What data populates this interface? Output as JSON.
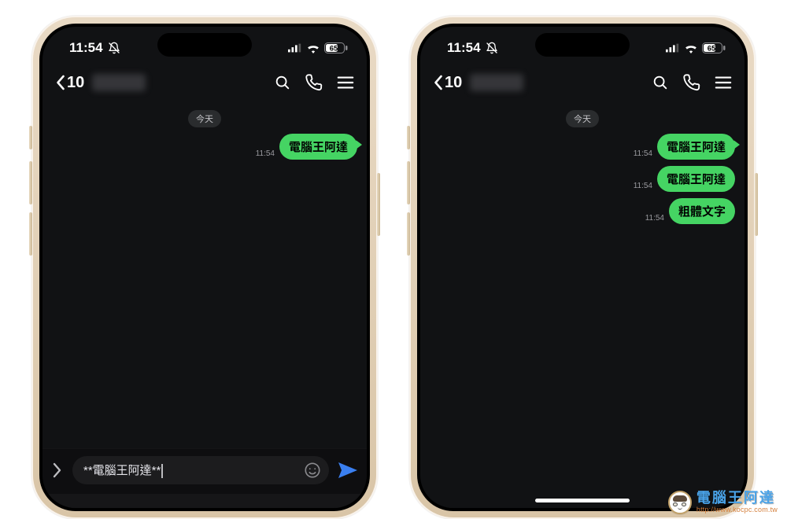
{
  "status": {
    "time": "11:54",
    "mute_icon": "bell-slash-icon",
    "cellular_bars": 3,
    "wifi_icon": "wifi-icon",
    "battery_pct": "65"
  },
  "nav": {
    "back_badge": "10",
    "contact_name_blurred": true,
    "icons": {
      "search": "search-icon",
      "call": "phone-icon",
      "menu": "menu-icon"
    }
  },
  "chat": {
    "date_label": "今天"
  },
  "left_phone": {
    "messages": [
      {
        "time": "11:54",
        "text": "電腦王阿達",
        "bold": true,
        "tail": true
      }
    ],
    "input": {
      "expand_icon": "chevron-right-icon",
      "text": "**電腦王阿達**",
      "face_icon": "smile-icon",
      "send_icon": "send-icon"
    }
  },
  "right_phone": {
    "messages": [
      {
        "time": "11:54",
        "text": "電腦王阿達",
        "bold": true,
        "tail": true
      },
      {
        "time": "11:54",
        "text": "電腦王阿達",
        "bold": true,
        "tail": false
      },
      {
        "time": "11:54",
        "text": "粗體文字",
        "bold": true,
        "tail": false
      }
    ]
  },
  "watermark": {
    "title": "電腦王阿達",
    "url": "http://www.kocpc.com.tw"
  }
}
